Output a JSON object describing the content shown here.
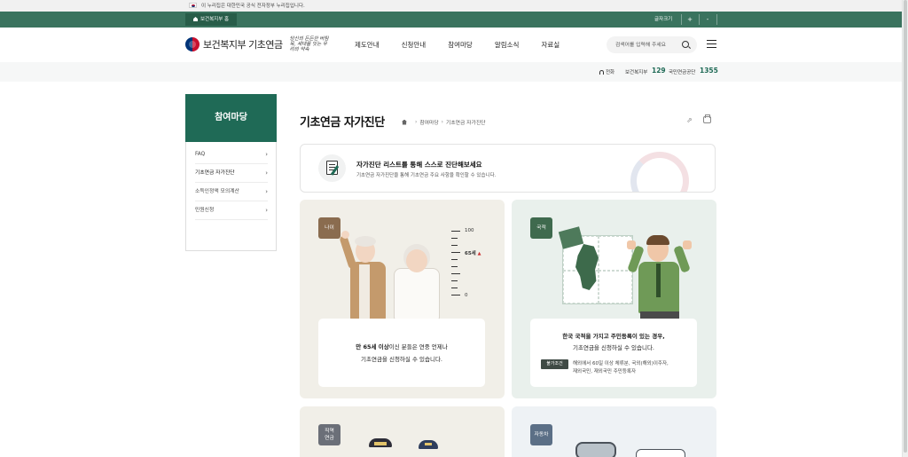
{
  "gov_banner": {
    "text": "이 누리집은 대한민국 공식 전자정부 누리집입니다."
  },
  "util_bar": {
    "home_label": "보건복지부 홈",
    "font_size_label": "글자크기",
    "zoom_in": "+",
    "zoom_out": "-"
  },
  "header": {
    "logo_name": "보건복지부 기초연금",
    "logo_slogan": "당신의 든든한 버팀목, 세대를 잇는 우리의 약속",
    "nav": [
      "제도안내",
      "신청안내",
      "참여마당",
      "알림소식",
      "자료실"
    ],
    "search_placeholder": "검색어를 입력해 주세요"
  },
  "stats": {
    "phone_label": "전화",
    "org1": "보건복지부",
    "org1_num": "129",
    "org2": "국민연금공단",
    "org2_num": "1355"
  },
  "sidebar": {
    "title": "참여마당",
    "items": [
      {
        "label": "FAQ"
      },
      {
        "label": "기초연금 자가진단"
      },
      {
        "label": "소득인정액 모의계산"
      },
      {
        "label": "민원신청"
      }
    ]
  },
  "page": {
    "title": "기초연금 자가진단",
    "breadcrumb": [
      "참여마당",
      "기초연금 자가진단"
    ]
  },
  "intro": {
    "heading": "자가진단 리스트를 통해 스스로 진단해보세요",
    "sub": "기초연금 자가진단을 통해 기초연금 주요 사항을 확인할 수 있습니다."
  },
  "cards": {
    "age": {
      "badge": "나이",
      "ruler_top": "100",
      "ruler_bottom": "0",
      "ruler_mark": "65세",
      "line1_strong": "만 65세 이상",
      "line1_rest": "이신 분들은 연중 언제나",
      "line2": "기초연금을 신청하실 수 있습니다."
    },
    "nationality": {
      "badge": "국적",
      "line1": "한국 국적을 가지고 주민등록이 있는 경우,",
      "line2": "기초연금을 신청하실 수 있습니다.",
      "cond_tag": "불가조건",
      "cond_line1": "해외에서 60일 이상 체류분, 국외(해외)이주자,",
      "cond_line2": "재외국민, 재외국민 주민등록자"
    },
    "job": {
      "badge_line1": "직역",
      "badge_line2": "연금"
    },
    "car": {
      "badge": "자동차"
    }
  },
  "colors": {
    "brand_green": "#1f6a56",
    "util_green": "#3a735e",
    "age_bg": "#f1efe8",
    "nat_bg": "#e9f0ec"
  }
}
